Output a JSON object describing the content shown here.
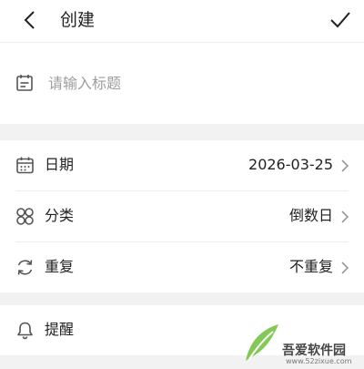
{
  "header": {
    "title": "创建",
    "back_icon": "chevron-left-icon",
    "confirm_icon": "checkmark-icon"
  },
  "title_field": {
    "icon": "calendar-note-icon",
    "placeholder": "请输入标题",
    "value": ""
  },
  "settings": {
    "date": {
      "label": "日期",
      "value": "2026-03-25",
      "icon": "calendar-icon"
    },
    "category": {
      "label": "分类",
      "value": "倒数日",
      "icon": "four-petal-icon"
    },
    "repeat": {
      "label": "重复",
      "value": "不重复",
      "icon": "refresh-icon"
    }
  },
  "reminder": {
    "label": "提醒",
    "icon": "bell-icon"
  },
  "watermark": {
    "name": "吾爱软件园",
    "url": "www.52zixue.com"
  },
  "colors": {
    "background": "#f2f2f2",
    "card": "#ffffff",
    "text": "#222222",
    "muted": "#9d9d9d",
    "icon": "#555555"
  }
}
